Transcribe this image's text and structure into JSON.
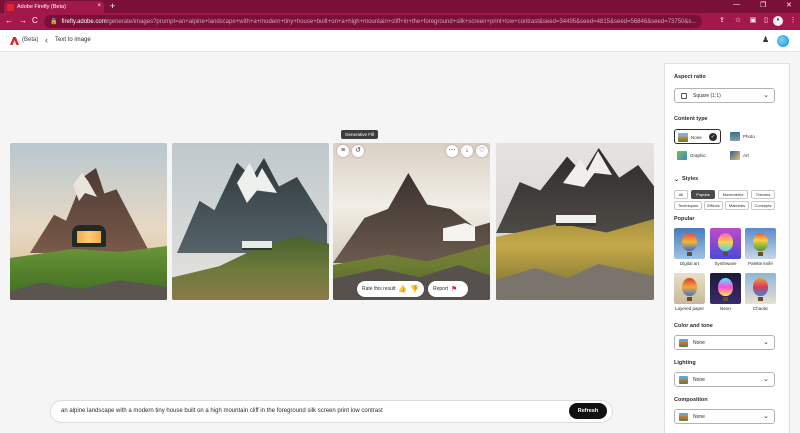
{
  "browser": {
    "tab_title": "Adobe Firefly (Beta)",
    "tab_close": "×",
    "new_tab": "+",
    "minimize": "—",
    "maximize": "❐",
    "close": "✕",
    "back": "←",
    "forward": "→",
    "reload": "C",
    "lock": "🔒",
    "url_host": "firefly.adobe.com",
    "url_path": "/generate/images?prompt=an+alpine+landscape+with+a+modern+tiny+house+built+on+a+high+mountain+cliff+in+the+foreground+silk+screen+print+low+contrast&seed=34495&seed=4815&seed=56846&seed=73750&s..."
  },
  "header": {
    "beta_label": "(Beta)",
    "back_icon": "‹",
    "breadcrumb": "Text to image"
  },
  "images": {
    "tooltip": "Generative Fill",
    "rate_label": "Rate this result",
    "report_label": "Report"
  },
  "prompt": {
    "text": "an alpine landscape with a modern tiny house built on a high mountain cliff in the foreground silk screen print low contrast",
    "refresh_label": "Refresh"
  },
  "panel": {
    "aspect_ratio": {
      "heading": "Aspect ratio",
      "value": "Square (1:1)"
    },
    "content_type": {
      "heading": "Content type",
      "options": [
        "None",
        "Photo",
        "Graphic",
        "Art"
      ]
    },
    "styles": {
      "heading": "Styles",
      "chips": [
        "All",
        "Popular",
        "Movements",
        "Themes",
        "Techniques",
        "Effects",
        "Materials",
        "Concepts"
      ],
      "popular_heading": "Popular",
      "tiles": [
        "Digital art",
        "Synthwave",
        "Palette knife",
        "Layered paper",
        "Neon",
        "Chaotic"
      ]
    },
    "color_tone": {
      "heading": "Color and tone",
      "value": "None"
    },
    "lighting": {
      "heading": "Lighting",
      "value": "None"
    },
    "composition": {
      "heading": "Composition",
      "value": "None"
    }
  }
}
